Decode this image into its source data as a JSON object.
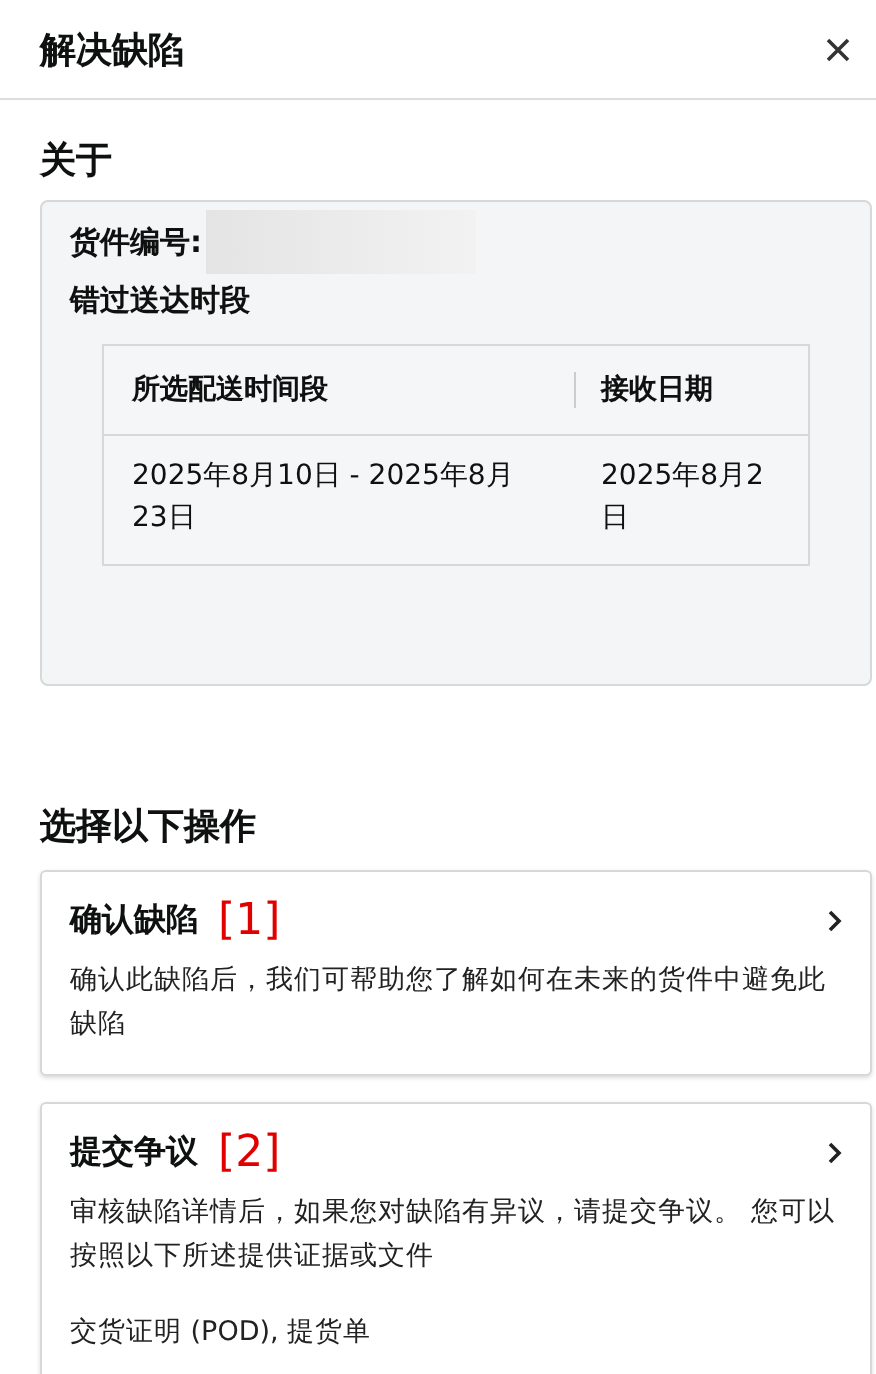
{
  "header": {
    "title": "解决缺陷"
  },
  "about": {
    "heading": "关于",
    "shipment_label": "货件编号:",
    "section_title": "错过送达时段",
    "table": {
      "columns": [
        "所选配送时间段",
        "接收日期"
      ],
      "rows": [
        [
          "2025年8月10日 - 2025年8月23日",
          "2025年8月2日"
        ]
      ]
    }
  },
  "actions": {
    "heading": "选择以下操作",
    "options": [
      {
        "title": "确认缺陷",
        "marker": "[1]",
        "description": "确认此缺陷后，我们可帮助您了解如何在未来的货件中避免此缺陷"
      },
      {
        "title": "提交争议",
        "marker": "[2]",
        "description": "审核缺陷详情后，如果您对缺陷有异议，请提交争议。 您可以按照以下所述提供证据或文件",
        "note": "交货证明 (POD), 提货单"
      }
    ]
  }
}
